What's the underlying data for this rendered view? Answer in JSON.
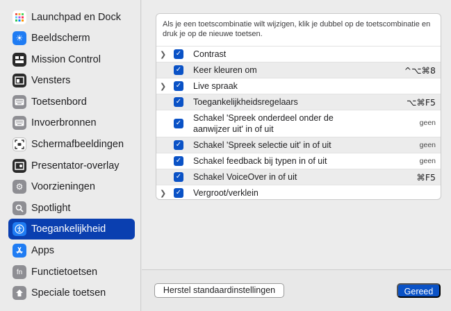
{
  "sidebar": {
    "items": [
      {
        "label": "Launchpad en Dock",
        "icon": "launchpad-icon",
        "color": "#ffffff"
      },
      {
        "label": "Beeldscherm",
        "icon": "display-icon",
        "color": "#1f7cf3"
      },
      {
        "label": "Mission Control",
        "icon": "mission-control-icon",
        "color": "#2a2a2a"
      },
      {
        "label": "Vensters",
        "icon": "windows-icon",
        "color": "#2a2a2a"
      },
      {
        "label": "Toetsenbord",
        "icon": "keyboard-icon",
        "color": "#8e8e93"
      },
      {
        "label": "Invoerbronnen",
        "icon": "input-sources-icon",
        "color": "#8e8e93"
      },
      {
        "label": "Schermafbeeldingen",
        "icon": "screenshot-icon",
        "color": "#ffffff"
      },
      {
        "label": "Presentator-overlay",
        "icon": "presenter-overlay-icon",
        "color": "#2a2a2a"
      },
      {
        "label": "Voorzieningen",
        "icon": "services-icon",
        "color": "#8e8e93"
      },
      {
        "label": "Spotlight",
        "icon": "spotlight-icon",
        "color": "#8e8e93"
      },
      {
        "label": "Toegankelijkheid",
        "icon": "accessibility-icon",
        "color": "#1f7cf3",
        "active": true
      },
      {
        "label": "Apps",
        "icon": "app-store-icon",
        "color": "#1f7cf3"
      },
      {
        "label": "Functietoetsen",
        "icon": "function-keys-icon",
        "color": "#8e8e93"
      },
      {
        "label": "Speciale toetsen",
        "icon": "modifier-keys-icon",
        "color": "#8e8e93"
      }
    ]
  },
  "panel": {
    "description": "Als je een toetscombinatie wilt wijzigen, klik je dubbel op de toetscombinatie en druk je op de nieuwe toetsen.",
    "rows": [
      {
        "label": "Contrast",
        "shortcut": "",
        "expandable": true,
        "checked": true
      },
      {
        "label": "Keer kleuren om",
        "shortcut": "^⌥⌘8",
        "expandable": false,
        "checked": true
      },
      {
        "label": "Live spraak",
        "shortcut": "",
        "expandable": true,
        "checked": true
      },
      {
        "label": "Toegankelijkheidsregelaars",
        "shortcut": "⌥⌘F5",
        "expandable": false,
        "checked": true
      },
      {
        "label": "Schakel 'Spreek onderdeel onder de aanwijzer uit' in of uit",
        "shortcut": "geen",
        "expandable": false,
        "checked": true
      },
      {
        "label": "Schakel 'Spreek selectie uit' in of uit",
        "shortcut": "geen",
        "expandable": false,
        "checked": true
      },
      {
        "label": "Schakel feedback bij typen in of uit",
        "shortcut": "geen",
        "expandable": false,
        "checked": true
      },
      {
        "label": "Schakel VoiceOver in of uit",
        "shortcut": "⌘F5",
        "expandable": false,
        "checked": true
      },
      {
        "label": "Vergroot/verklein",
        "shortcut": "",
        "expandable": true,
        "checked": true
      }
    ]
  },
  "footer": {
    "reset_label": "Herstel standaardinstellingen",
    "done_label": "Gereed"
  },
  "colors": {
    "accent": "#0a52c6",
    "sidebar_active": "#0a3fb0"
  }
}
